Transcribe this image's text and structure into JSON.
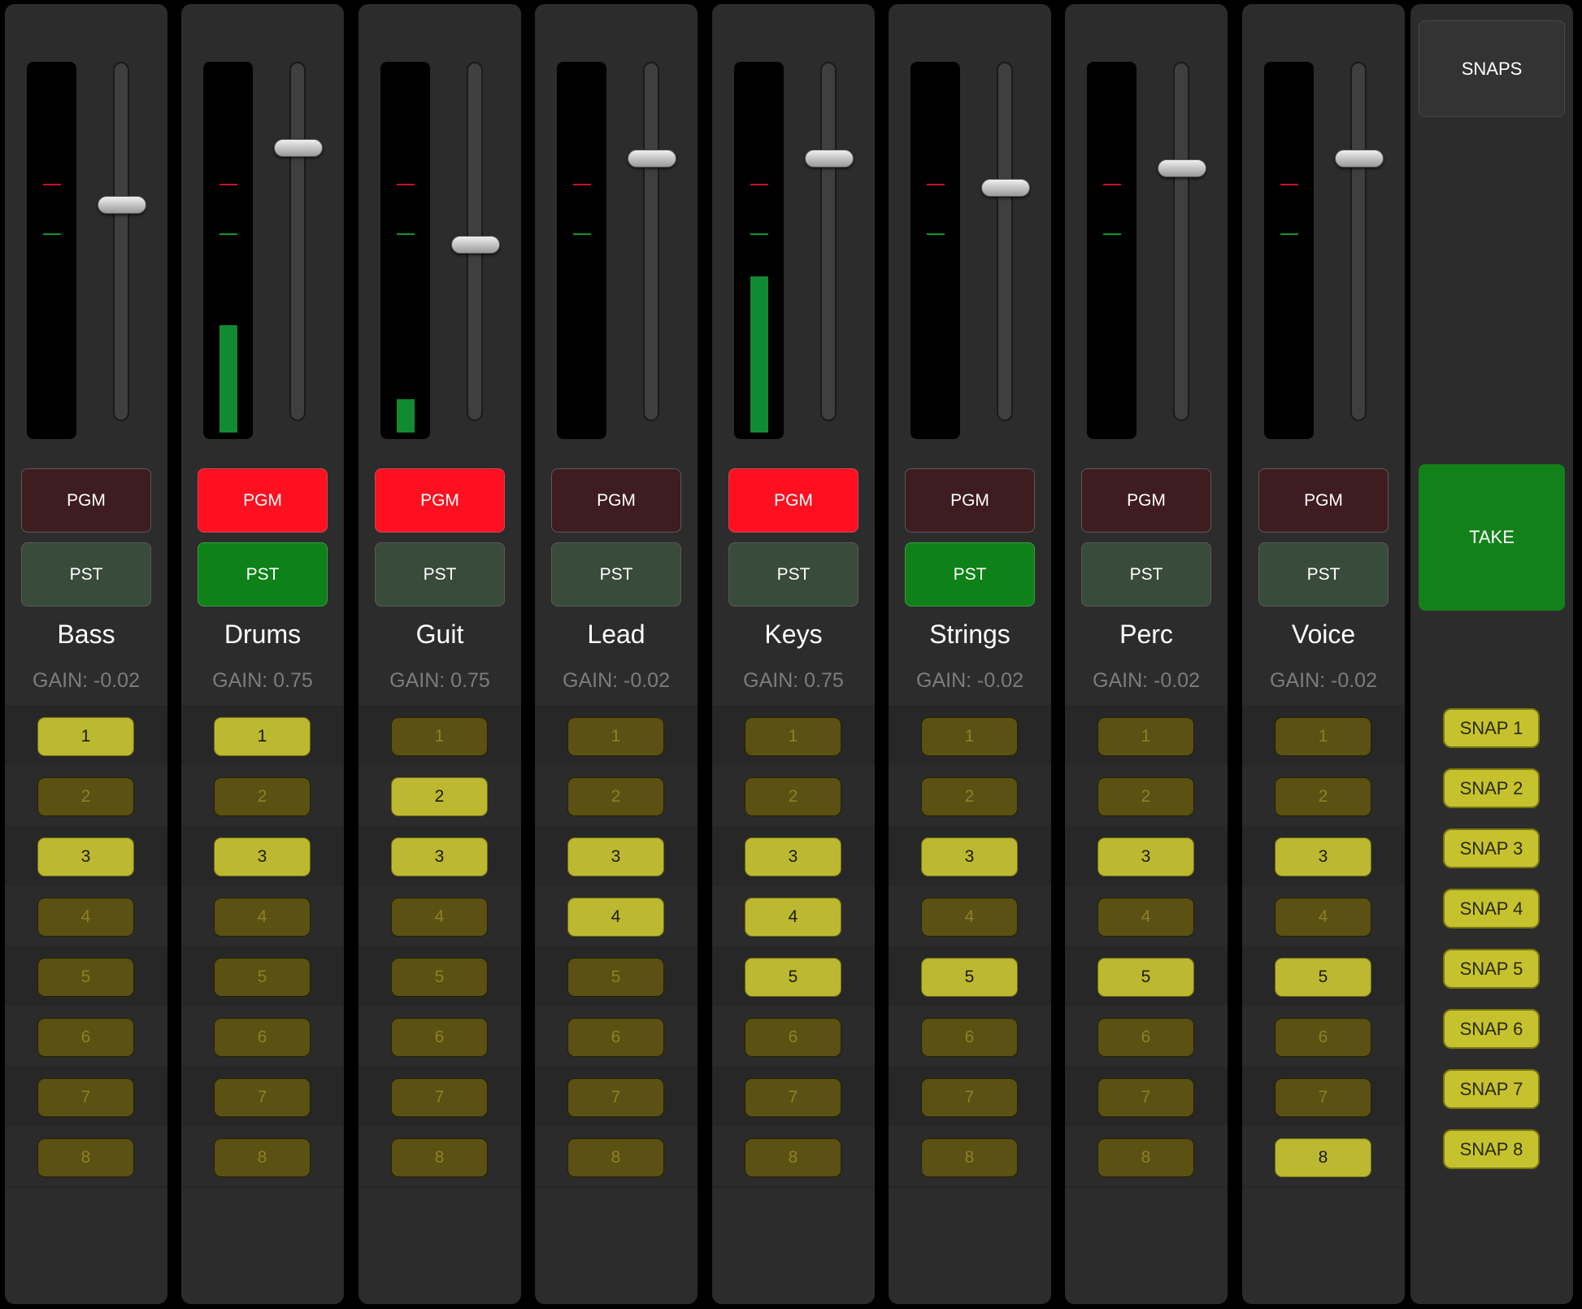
{
  "colors": {
    "pgm_on": "#fe1020",
    "pgm_off": "#3e1c1f",
    "pst_on": "#0e8118",
    "pst_off": "#394b3b",
    "group_on": "#bcb830",
    "group_off": "#5a5112",
    "meter": "#128a33",
    "take": "#128119"
  },
  "buttons": {
    "pgm_label": "PGM",
    "pst_label": "PST"
  },
  "group_labels": [
    "1",
    "2",
    "3",
    "4",
    "5",
    "6",
    "7",
    "8"
  ],
  "channels": [
    {
      "name": "Bass",
      "gain": "GAIN: -0.02",
      "fader_level": 0.61,
      "meter_level": 0.0,
      "pgm_on": false,
      "pst_on": false,
      "groups_on": [
        1,
        3
      ]
    },
    {
      "name": "Drums",
      "gain": "GAIN: 0.75",
      "fader_level": 0.78,
      "meter_level": 0.29,
      "pgm_on": true,
      "pst_on": true,
      "groups_on": [
        1,
        3
      ]
    },
    {
      "name": "Guit",
      "gain": "GAIN: 0.75",
      "fader_level": 0.49,
      "meter_level": 0.09,
      "pgm_on": true,
      "pst_on": false,
      "groups_on": [
        2,
        3
      ]
    },
    {
      "name": "Lead",
      "gain": "GAIN: -0.02",
      "fader_level": 0.75,
      "meter_level": 0.0,
      "pgm_on": false,
      "pst_on": false,
      "groups_on": [
        3,
        4
      ]
    },
    {
      "name": "Keys",
      "gain": "GAIN: 0.75",
      "fader_level": 0.75,
      "meter_level": 0.42,
      "pgm_on": true,
      "pst_on": false,
      "groups_on": [
        3,
        4,
        5
      ]
    },
    {
      "name": "Strings",
      "gain": "GAIN: -0.02",
      "fader_level": 0.66,
      "meter_level": 0.0,
      "pgm_on": false,
      "pst_on": true,
      "groups_on": [
        3,
        5
      ]
    },
    {
      "name": "Perc",
      "gain": "GAIN: -0.02",
      "fader_level": 0.72,
      "meter_level": 0.0,
      "pgm_on": false,
      "pst_on": false,
      "groups_on": [
        3,
        5
      ]
    },
    {
      "name": "Voice",
      "gain": "GAIN: -0.02",
      "fader_level": 0.75,
      "meter_level": 0.0,
      "pgm_on": false,
      "pst_on": false,
      "groups_on": [
        3,
        5,
        8
      ]
    }
  ],
  "snaps_panel": {
    "snaps_label": "SNAPS",
    "take_label": "TAKE",
    "snap_labels": [
      "SNAP 1",
      "SNAP 2",
      "SNAP 3",
      "SNAP 4",
      "SNAP 5",
      "SNAP 6",
      "SNAP 7",
      "SNAP 8"
    ]
  }
}
